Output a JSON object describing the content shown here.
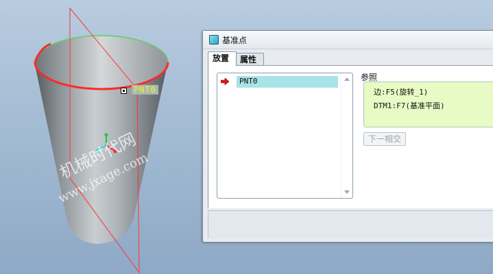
{
  "viewport": {
    "point_label": "PNT0",
    "watermark_cn": "机械时代网",
    "watermark_url": "www.jxage.com"
  },
  "dialog": {
    "title": "基准点",
    "tabs": [
      {
        "label": "放置",
        "active": true
      },
      {
        "label": "属性",
        "active": false
      }
    ],
    "point_list": [
      "PNT0"
    ],
    "references_label": "参照",
    "references": [
      "边:F5(旋转_1)",
      "DTM1:F7(基准平面)"
    ],
    "next_intersection_label": "下一相交"
  },
  "colors": {
    "selected_row": "#a8e3e7",
    "references_bg": "#e9fbc5",
    "point_label_text": "#f3f318"
  }
}
